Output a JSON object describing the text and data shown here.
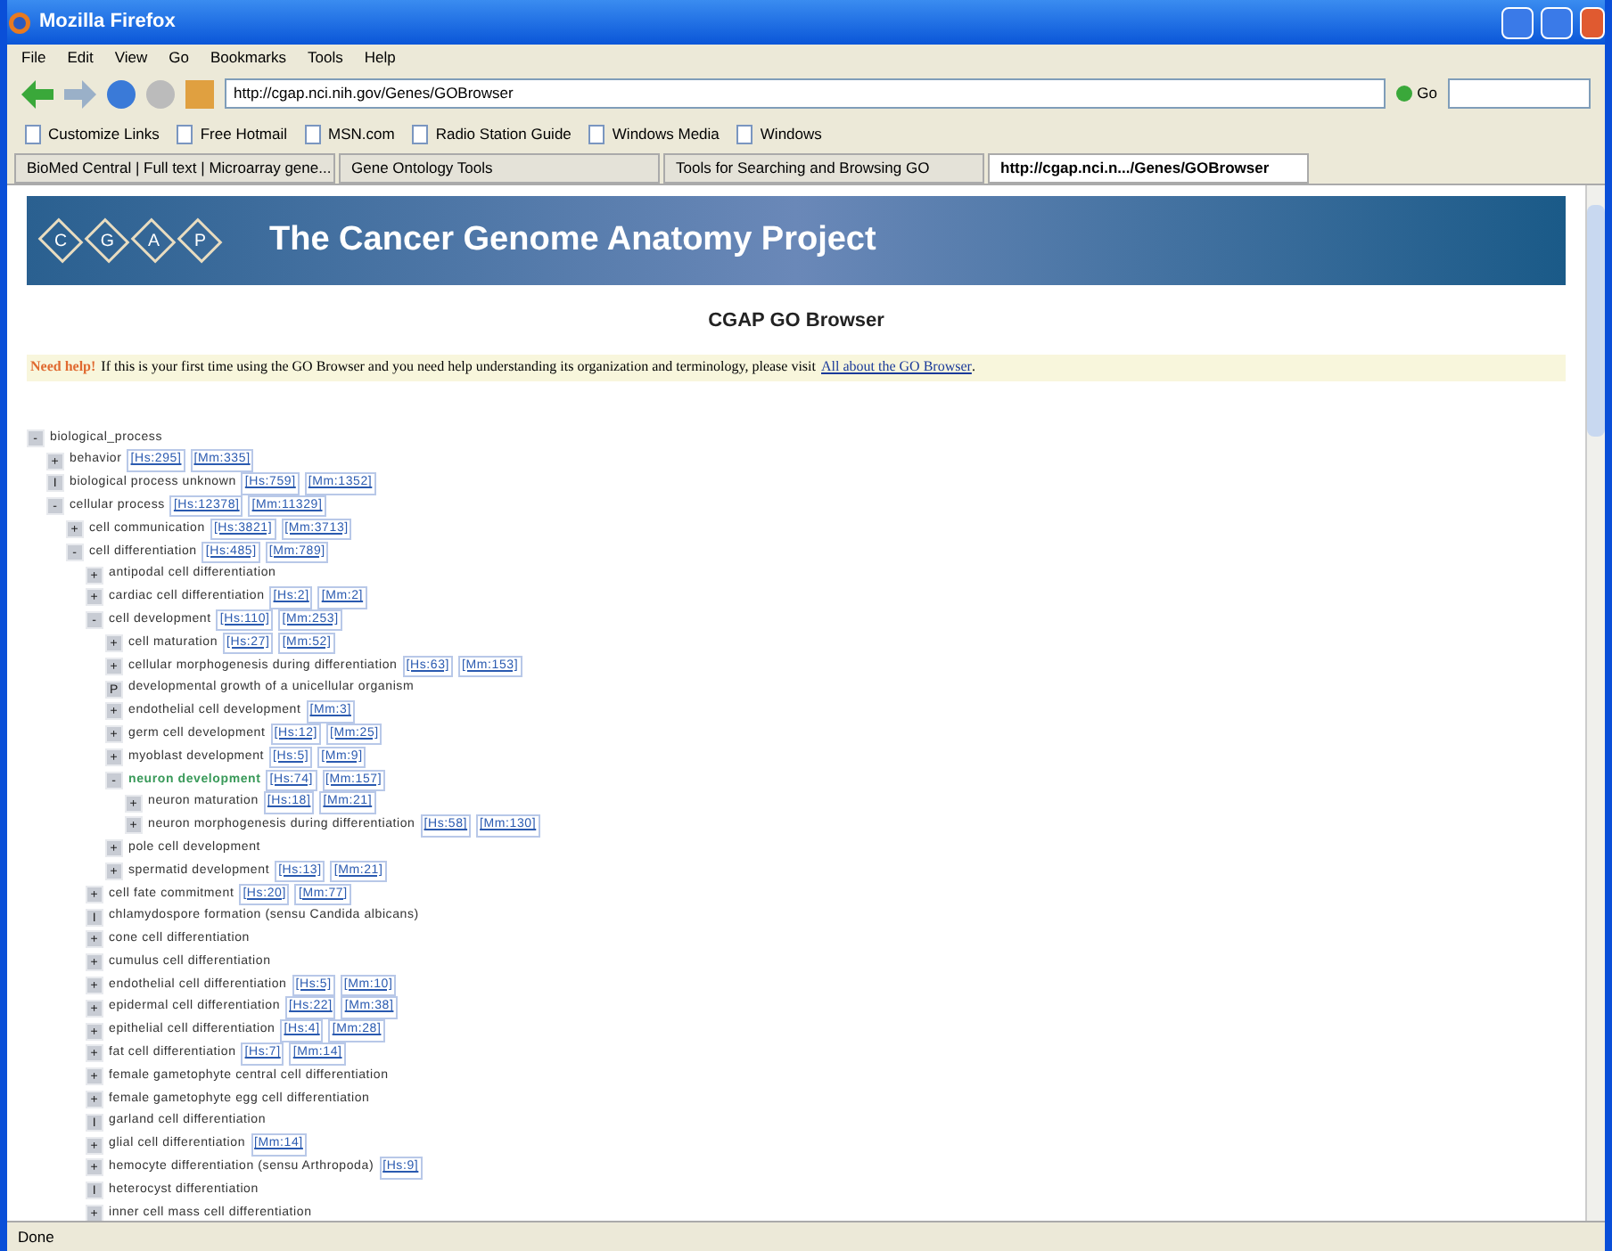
{
  "window": {
    "title": "Mozilla Firefox"
  },
  "menu": [
    "File",
    "Edit",
    "View",
    "Go",
    "Bookmarks",
    "Tools",
    "Help"
  ],
  "address": {
    "value": "http://cgap.nci.nih.gov/Genes/GOBrowser",
    "go": "Go"
  },
  "bookmarks": [
    "Customize Links",
    "Free Hotmail",
    "MSN.com",
    "Radio Station Guide",
    "Windows Media",
    "Windows"
  ],
  "tabs": [
    {
      "label": "BioMed Central | Full text | Microarray gene...",
      "selected": false
    },
    {
      "label": "Gene Ontology Tools",
      "selected": false
    },
    {
      "label": "Tools for Searching and Browsing GO",
      "selected": false
    },
    {
      "label": "http://cgap.nci.n.../Genes/GOBrowser",
      "selected": true
    }
  ],
  "banner": {
    "logo": [
      "C",
      "G",
      "A",
      "P"
    ],
    "title": "The Cancer Genome Anatomy Project"
  },
  "page_title": "CGAP GO Browser",
  "help": {
    "label": "Need help!",
    "text": "If this is your first time using the GO Browser and you need help understanding its organization and terminology, please visit",
    "link": "All about the GO Browser",
    "end": "."
  },
  "tree": [
    {
      "toggle": "-",
      "label": "biological_process",
      "children": [
        {
          "toggle": "+",
          "label": "behavior",
          "links": [
            "[Hs:295]",
            "[Mm:335]"
          ]
        },
        {
          "toggle": "I",
          "label": "biological process unknown",
          "links": [
            "[Hs:759]",
            "[Mm:1352]"
          ]
        },
        {
          "toggle": "-",
          "label": "cellular process",
          "links": [
            "[Hs:12378]",
            "[Mm:11329]"
          ],
          "children": [
            {
              "toggle": "+",
              "label": "cell communication",
              "links": [
                "[Hs:3821]",
                "[Mm:3713]"
              ]
            },
            {
              "toggle": "-",
              "label": "cell differentiation",
              "links": [
                "[Hs:485]",
                "[Mm:789]"
              ],
              "children": [
                {
                  "toggle": "+",
                  "label": "antipodal cell differentiation"
                },
                {
                  "toggle": "+",
                  "label": "cardiac cell differentiation",
                  "links": [
                    "[Hs:2]",
                    "[Mm:2]"
                  ]
                },
                {
                  "toggle": "-",
                  "label": "cell development",
                  "links": [
                    "[Hs:110]",
                    "[Mm:253]"
                  ],
                  "children": [
                    {
                      "toggle": "+",
                      "label": "cell maturation",
                      "links": [
                        "[Hs:27]",
                        "[Mm:52]"
                      ]
                    },
                    {
                      "toggle": "+",
                      "label": "cellular morphogenesis during differentiation",
                      "links": [
                        "[Hs:63]",
                        "[Mm:153]"
                      ]
                    },
                    {
                      "toggle": "P",
                      "label": "developmental growth of a unicellular organism"
                    },
                    {
                      "toggle": "+",
                      "label": "endothelial cell development",
                      "links": [
                        "[Mm:3]"
                      ]
                    },
                    {
                      "toggle": "+",
                      "label": "germ cell development",
                      "links": [
                        "[Hs:12]",
                        "[Mm:25]"
                      ]
                    },
                    {
                      "toggle": "+",
                      "label": "myoblast development",
                      "links": [
                        "[Hs:5]",
                        "[Mm:9]"
                      ]
                    },
                    {
                      "toggle": "-",
                      "label": "neuron development",
                      "selected": true,
                      "links": [
                        "[Hs:74]",
                        "[Mm:157]"
                      ],
                      "children": [
                        {
                          "toggle": "+",
                          "label": "neuron maturation",
                          "links": [
                            "[Hs:18]",
                            "[Mm:21]"
                          ]
                        },
                        {
                          "toggle": "+",
                          "label": "neuron morphogenesis during differentiation",
                          "links": [
                            "[Hs:58]",
                            "[Mm:130]"
                          ]
                        }
                      ]
                    },
                    {
                      "toggle": "+",
                      "label": "pole cell development"
                    },
                    {
                      "toggle": "+",
                      "label": "spermatid development",
                      "links": [
                        "[Hs:13]",
                        "[Mm:21]"
                      ]
                    }
                  ]
                },
                {
                  "toggle": "+",
                  "label": "cell fate commitment",
                  "links": [
                    "[Hs:20]",
                    "[Mm:77]"
                  ]
                },
                {
                  "toggle": "I",
                  "label": "chlamydospore formation (sensu Candida albicans)"
                },
                {
                  "toggle": "+",
                  "label": "cone cell differentiation"
                },
                {
                  "toggle": "+",
                  "label": "cumulus cell differentiation"
                },
                {
                  "toggle": "+",
                  "label": "endothelial cell differentiation",
                  "links": [
                    "[Hs:5]",
                    "[Mm:10]"
                  ]
                },
                {
                  "toggle": "+",
                  "label": "epidermal cell differentiation",
                  "links": [
                    "[Hs:22]",
                    "[Mm:38]"
                  ]
                },
                {
                  "toggle": "+",
                  "label": "epithelial cell differentiation",
                  "links": [
                    "[Hs:4]",
                    "[Mm:28]"
                  ]
                },
                {
                  "toggle": "+",
                  "label": "fat cell differentiation",
                  "links": [
                    "[Hs:7]",
                    "[Mm:14]"
                  ]
                },
                {
                  "toggle": "+",
                  "label": "female gametophyte central cell differentiation"
                },
                {
                  "toggle": "+",
                  "label": "female gametophyte egg cell differentiation"
                },
                {
                  "toggle": "I",
                  "label": "garland cell differentiation"
                },
                {
                  "toggle": "+",
                  "label": "glial cell differentiation",
                  "links": [
                    "[Mm:14]"
                  ]
                },
                {
                  "toggle": "+",
                  "label": "hemocyte differentiation (sensu Arthropoda)",
                  "links": [
                    "[Hs:9]"
                  ]
                },
                {
                  "toggle": "I",
                  "label": "heterocyst differentiation"
                },
                {
                  "toggle": "+",
                  "label": "inner cell mass cell differentiation"
                }
              ]
            }
          ]
        }
      ]
    }
  ],
  "status_bar": "Done"
}
